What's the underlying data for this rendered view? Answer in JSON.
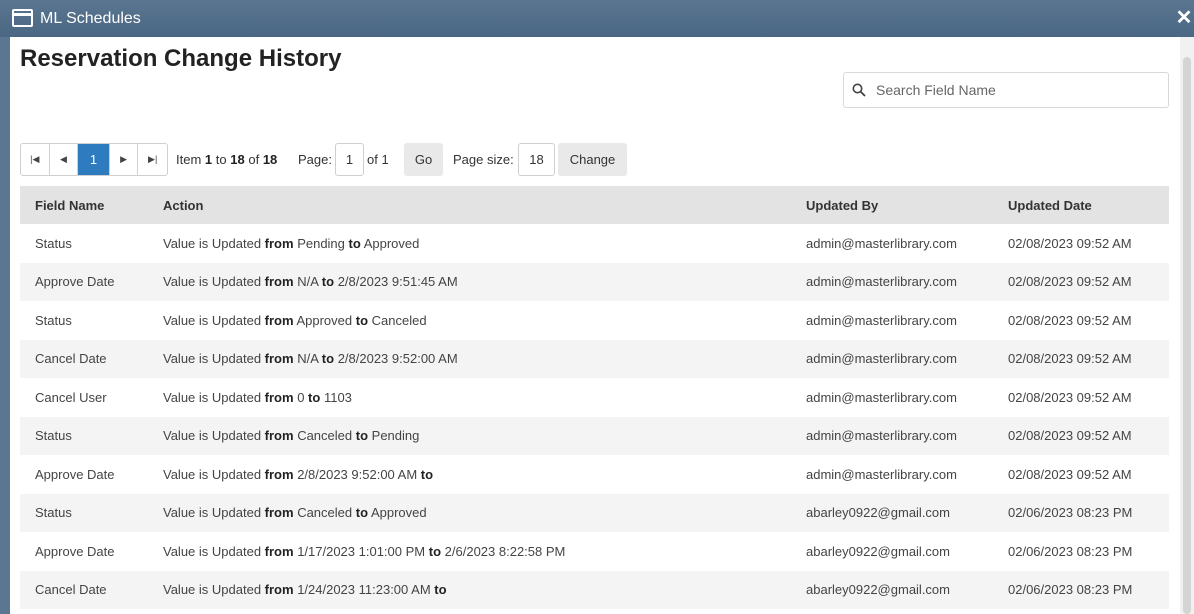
{
  "window": {
    "title": "ML Schedules"
  },
  "page": {
    "title": "Reservation Change History"
  },
  "search": {
    "placeholder": "Search Field Name",
    "value": ""
  },
  "pager": {
    "current_page": "1",
    "item_label": "Item",
    "item_from": "1",
    "to_label": "to",
    "item_to": "18",
    "of_label": "of",
    "item_total": "18",
    "page_label": "Page:",
    "page_value": "1",
    "page_of": "of 1",
    "go_label": "Go",
    "page_size_label": "Page size:",
    "page_size_value": "18",
    "change_label": "Change"
  },
  "table": {
    "columns": [
      "Field Name",
      "Action",
      "Updated By",
      "Updated Date"
    ],
    "action_prefix": "Value is Updated",
    "from_word": "from",
    "to_word": "to",
    "rows": [
      {
        "field": "Status",
        "from": "Pending",
        "to": "Approved",
        "by": "admin@masterlibrary.com",
        "date": "02/08/2023 09:52 AM"
      },
      {
        "field": "Approve Date",
        "from": "N/A",
        "to": "2/8/2023 9:51:45 AM",
        "by": "admin@masterlibrary.com",
        "date": "02/08/2023 09:52 AM"
      },
      {
        "field": "Status",
        "from": "Approved",
        "to": "Canceled",
        "by": "admin@masterlibrary.com",
        "date": "02/08/2023 09:52 AM"
      },
      {
        "field": "Cancel Date",
        "from": "N/A",
        "to": "2/8/2023 9:52:00 AM",
        "by": "admin@masterlibrary.com",
        "date": "02/08/2023 09:52 AM"
      },
      {
        "field": "Cancel User",
        "from": "0",
        "to": "1103",
        "by": "admin@masterlibrary.com",
        "date": "02/08/2023 09:52 AM"
      },
      {
        "field": "Status",
        "from": "Canceled",
        "to": "Pending",
        "by": "admin@masterlibrary.com",
        "date": "02/08/2023 09:52 AM"
      },
      {
        "field": "Approve Date",
        "from": "2/8/2023 9:52:00 AM",
        "to": "",
        "by": "admin@masterlibrary.com",
        "date": "02/08/2023 09:52 AM"
      },
      {
        "field": "Status",
        "from": "Canceled",
        "to": "Approved",
        "by": "abarley0922@gmail.com",
        "date": "02/06/2023 08:23 PM"
      },
      {
        "field": "Approve Date",
        "from": "1/17/2023 1:01:00 PM",
        "to": "2/6/2023 8:22:58 PM",
        "by": "abarley0922@gmail.com",
        "date": "02/06/2023 08:23 PM"
      },
      {
        "field": "Cancel Date",
        "from": "1/24/2023 11:23:00 AM",
        "to": "",
        "by": "abarley0922@gmail.com",
        "date": "02/06/2023 08:23 PM"
      }
    ]
  }
}
